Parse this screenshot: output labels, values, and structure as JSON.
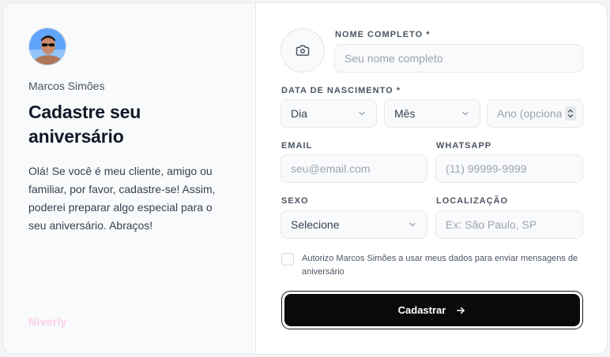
{
  "profile": {
    "owner_name": "Marcos Simões",
    "headline": "Cadastre seu aniversário",
    "message": "Olá! Se você é meu cliente, amigo ou familiar, por favor, cadastre-se! Assim, poderei preparar algo especial para o seu aniversário. Abraços!",
    "brand": "Niverly"
  },
  "form": {
    "full_name": {
      "label": "NOME COMPLETO *",
      "placeholder": "Seu nome completo"
    },
    "birth_date": {
      "label": "DATA DE NASCIMENTO *",
      "day": "Dia",
      "month": "Mês",
      "year_placeholder": "Ano (opcional)"
    },
    "email": {
      "label": "EMAIL",
      "placeholder": "seu@email.com"
    },
    "whatsapp": {
      "label": "WHATSAPP",
      "placeholder": "(11) 99999-9999"
    },
    "gender": {
      "label": "SEXO",
      "value": "Selecione"
    },
    "location": {
      "label": "LOCALIZAÇÃO",
      "placeholder": "Ex: São Paulo, SP"
    },
    "consent": "Autorizo Marcos Simões a usar meus dados para enviar mensagens de aniversário",
    "submit_label": "Cadastrar"
  },
  "icons": {
    "photo": "camera-icon",
    "select": "chevron-down-icon",
    "submit": "arrow-right-icon"
  },
  "colors": {
    "button": "#0a0a0a",
    "brand": "#fbcfe8",
    "field_bg": "#f9fafb",
    "field_border": "#e5e7eb"
  }
}
